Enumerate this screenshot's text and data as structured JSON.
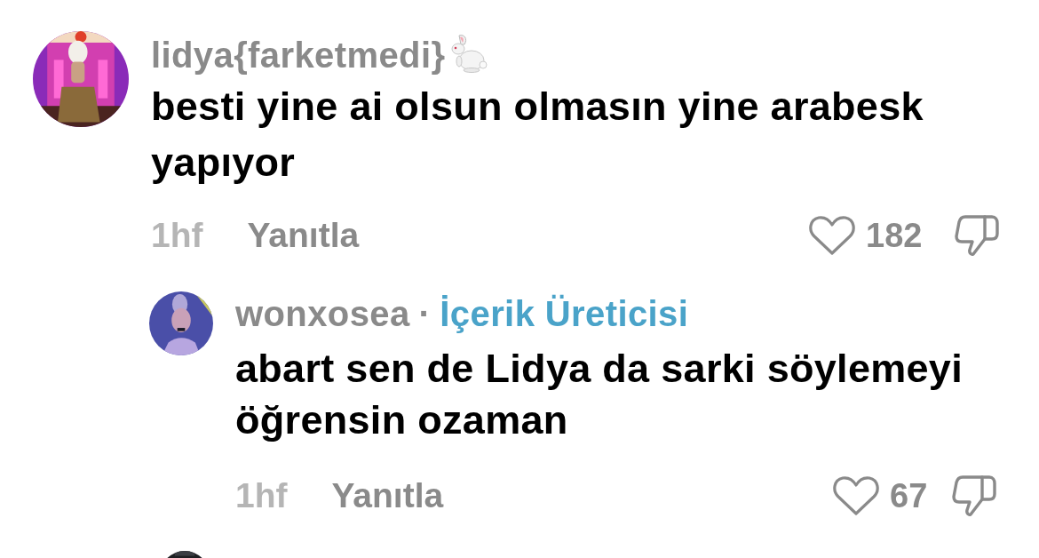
{
  "comments": [
    {
      "author": "lidya{farketmedi}",
      "emoji": {
        "kind": "rabbit"
      },
      "text": "besti yine ai olsun olmasın yine arabesk yapıyor",
      "time": "1hf",
      "reply_label": "Yanıtla",
      "likes": "182",
      "liked": false,
      "replies": [
        {
          "author": "wonxosea",
          "separator": "·",
          "badge": "İçerik Üreticisi",
          "text": "abart sen de Lidya da sarki söylemeyi öğrensin ozaman",
          "time": "1hf",
          "reply_label": "Yanıtla",
          "likes": "67",
          "liked": false
        }
      ]
    }
  ]
}
